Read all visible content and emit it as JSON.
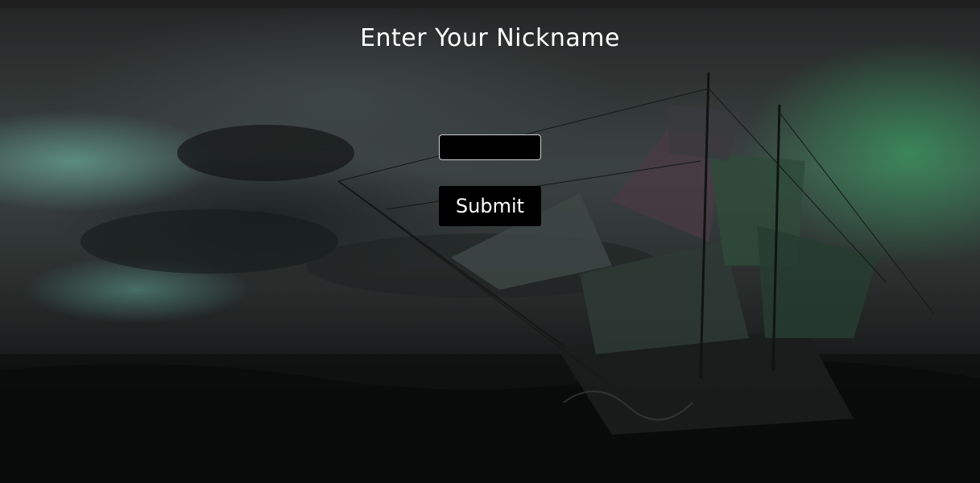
{
  "page": {
    "title": "Enter Your Nickname"
  },
  "form": {
    "nickname_value": "",
    "nickname_placeholder": "",
    "submit_label": "Submit"
  },
  "colors": {
    "text": "#ffffff",
    "control_background": "#000000",
    "input_border": "#d0d0d0"
  }
}
